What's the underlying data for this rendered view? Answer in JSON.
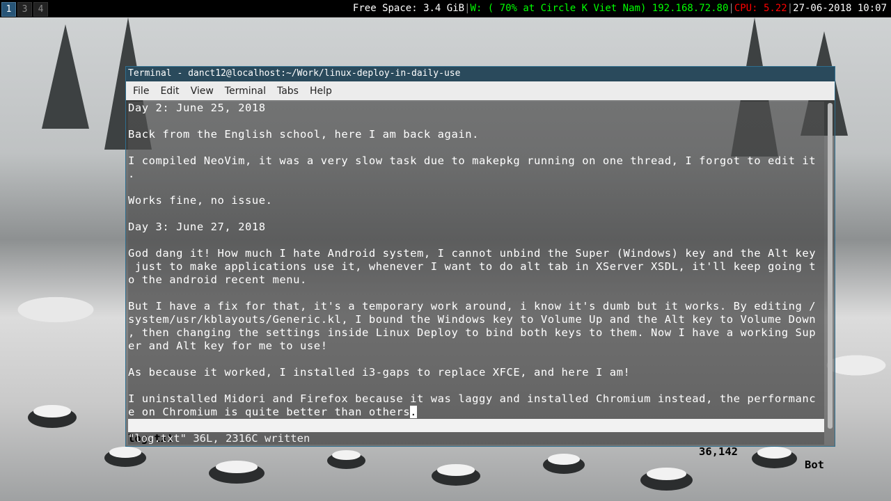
{
  "topbar": {
    "workspaces": [
      {
        "label": "1",
        "active": true
      },
      {
        "label": "3",
        "active": false
      },
      {
        "label": "4",
        "active": false
      }
    ],
    "free_space": "Free Space: 3.4 GiB",
    "wifi": "W: ( 70% at Circle K Viet Nam) 192.168.72.80",
    "cpu_label": "CPU: ",
    "cpu_value": "5.22",
    "datetime": "27-06-2018 10:07",
    "colors": {
      "wifi": "#00ff00",
      "cpu": "#ff0000"
    }
  },
  "window": {
    "title": "Terminal - danct12@localhost:~/Work/linux-deploy-in-daily-use",
    "menu": [
      "File",
      "Edit",
      "View",
      "Terminal",
      "Tabs",
      "Help"
    ]
  },
  "editor": {
    "lines": [
      "Day 2: June 25, 2018",
      "",
      "Back from the English school, here I am back again.",
      "",
      "I compiled NeoVim, it was a very slow task due to makepkg running on one thread, I forgot to edit it",
      ".",
      "",
      "Works fine, no issue.",
      "",
      "Day 3: June 27, 2018",
      "",
      "God dang it! How much I hate Android system, I cannot unbind the Super (Windows) key and the Alt key",
      " just to make applications use it, whenever I want to do alt tab in XServer XSDL, it'll keep going t",
      "o the android recent menu.",
      "",
      "But I have a fix for that, it's a temporary work around, i know it's dumb but it works. By editing /",
      "system/usr/kblayouts/Generic.kl, I bound the Windows key to Volume Up and the Alt key to Volume Down",
      ", then changing the settings inside Linux Deploy to bind both keys to them. Now I have a working Sup",
      "er and Alt key for me to use!",
      "",
      "As because it worked, I installed i3-gaps to replace XFCE, and here I am!",
      "",
      "I uninstalled Midori and Firefox because it was laggy and installed Chromium instead, the performanc",
      "e on Chromium is quite better than others"
    ],
    "cursor_char": ".",
    "statusline": {
      "file": "log.txt",
      "position": "36,142",
      "scroll": "Bot"
    },
    "message": "\"log.txt\" 36L, 2316C written"
  }
}
